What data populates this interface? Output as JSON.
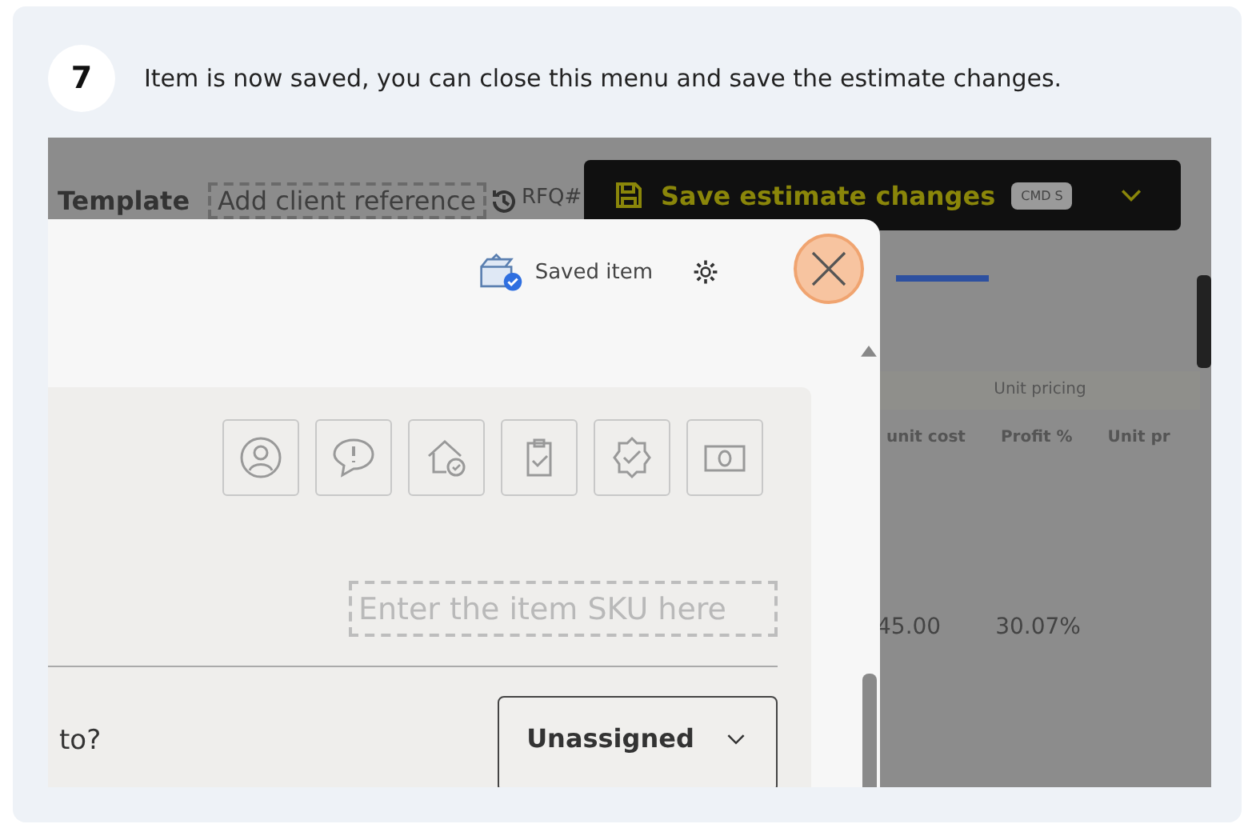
{
  "step": {
    "number": "7",
    "instruction": "Item is now saved, you can close this menu and save the estimate changes."
  },
  "screenshot": {
    "background": {
      "template_label": "Template",
      "client_reference_placeholder": "Add client reference",
      "rfq_label": "RFQ#",
      "save_button": {
        "label": "Save estimate changes",
        "shortcut": "CMD S"
      },
      "table": {
        "group_header": "Unit pricing",
        "columns": [
          "unit cost",
          "Profit %",
          "Unit pr"
        ],
        "rows": [
          {
            "unit_cost": "45.00",
            "profit": "30.07%"
          }
        ]
      }
    },
    "panel": {
      "status": "Saved item",
      "sku_field": {
        "placeholder": "Enter the item SKU here"
      },
      "question": "to?",
      "assignee_dropdown": {
        "value": "Unassigned"
      }
    }
  }
}
